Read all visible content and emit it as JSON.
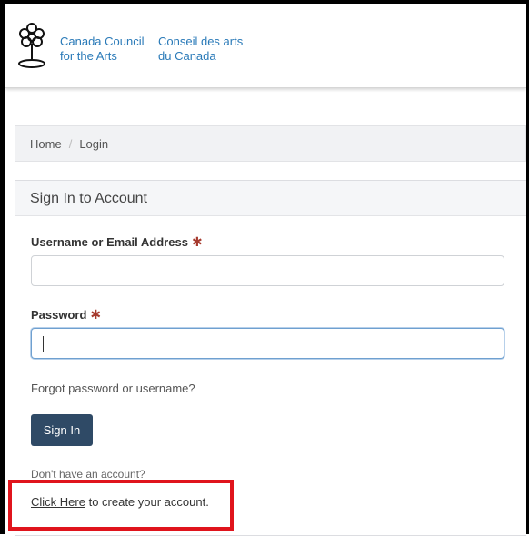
{
  "logo": {
    "icon": "tree-logo-icon",
    "name_en_line1": "Canada Council",
    "name_en_line2": "for the Arts",
    "name_fr_line1": "Conseil des arts",
    "name_fr_line2": "du Canada"
  },
  "breadcrumb": {
    "home": "Home",
    "separator": "/",
    "current": "Login"
  },
  "panel": {
    "title": "Sign In to Account",
    "username_label": "Username or Email Address",
    "username_value": "",
    "password_label": "Password",
    "password_value": "",
    "required_mark": "✱",
    "forgot_link": "Forgot password or username?",
    "signin_button": "Sign In",
    "no_account_text": "Don't have an account?",
    "click_here_link": "Click Here",
    "create_account_text": " to create your account."
  },
  "colors": {
    "accent_blue": "#2a7ab8",
    "button_bg": "#2f4a66",
    "required": "#a63a2e",
    "highlight": "#e0141c"
  }
}
